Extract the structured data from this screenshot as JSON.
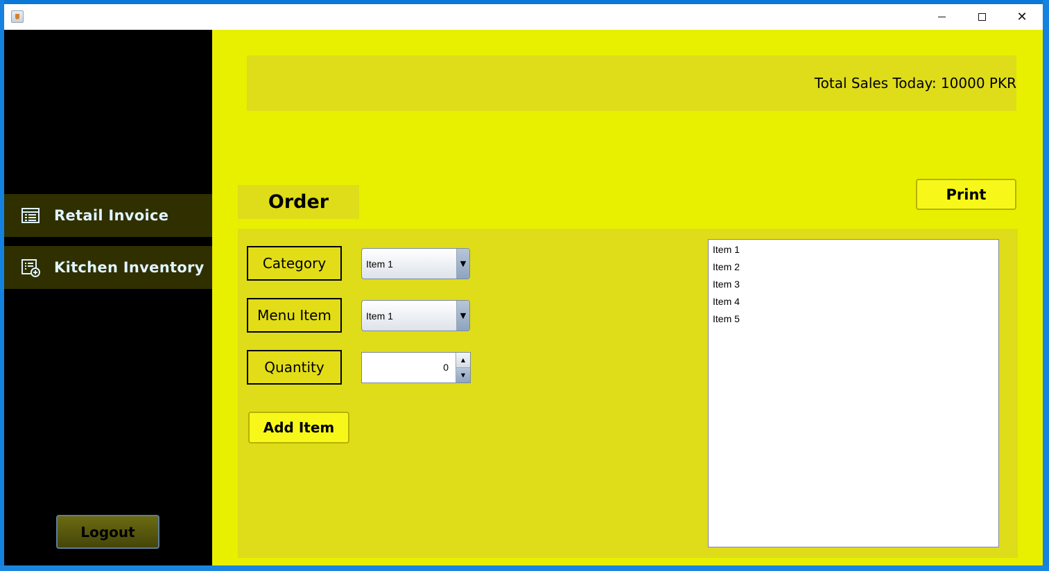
{
  "window": {
    "title": "",
    "controls": {
      "minimize_icon": "minimize-icon",
      "maximize_icon": "maximize-icon",
      "close_icon": "close-icon"
    }
  },
  "sidebar": {
    "items": [
      {
        "label": "Retail Invoice",
        "icon": "invoice-icon"
      },
      {
        "label": "Kitchen Inventory",
        "icon": "inventory-icon"
      }
    ],
    "logout_label": "Logout"
  },
  "header": {
    "total_sales": "Total Sales Today: 10000 PKR"
  },
  "order": {
    "title": "Order",
    "print_label": "Print",
    "fields": {
      "category_label": "Category",
      "category_value": "Item 1",
      "menu_item_label": "Menu Item",
      "menu_item_value": "Item 1",
      "quantity_label": "Quantity",
      "quantity_value": "0"
    },
    "add_item_label": "Add Item",
    "list_items": [
      "Item 1",
      "Item 2",
      "Item 3",
      "Item 4",
      "Item 5"
    ]
  },
  "colors": {
    "background": "#e8f000",
    "panel": "#dfdc1a",
    "sidebar": "#000000",
    "nav_highlight": "#302f00",
    "button": "#f7f81a"
  }
}
